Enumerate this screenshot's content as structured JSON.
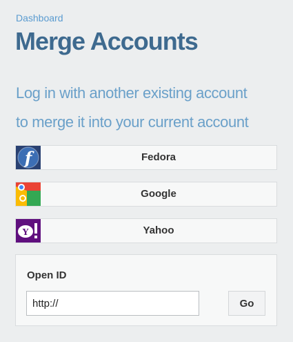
{
  "breadcrumb": {
    "label": "Dashboard"
  },
  "header": {
    "title": "Merge Accounts"
  },
  "intro": {
    "line1": "Log in with another existing account",
    "line2": "to merge it into your current account"
  },
  "providers": [
    {
      "label": "Fedora",
      "icon": "fedora-logo-icon",
      "color": "#294172"
    },
    {
      "label": "Google",
      "icon": "google-logo-icon",
      "color": "#4285f4"
    },
    {
      "label": "Yahoo",
      "icon": "yahoo-logo-icon",
      "color": "#5f0f7e"
    }
  ],
  "openid": {
    "label": "Open ID",
    "value": "http://",
    "go_label": "Go"
  },
  "colors": {
    "background": "#eceeef",
    "title": "#3e6a8f",
    "accent": "#6aa0c9"
  }
}
